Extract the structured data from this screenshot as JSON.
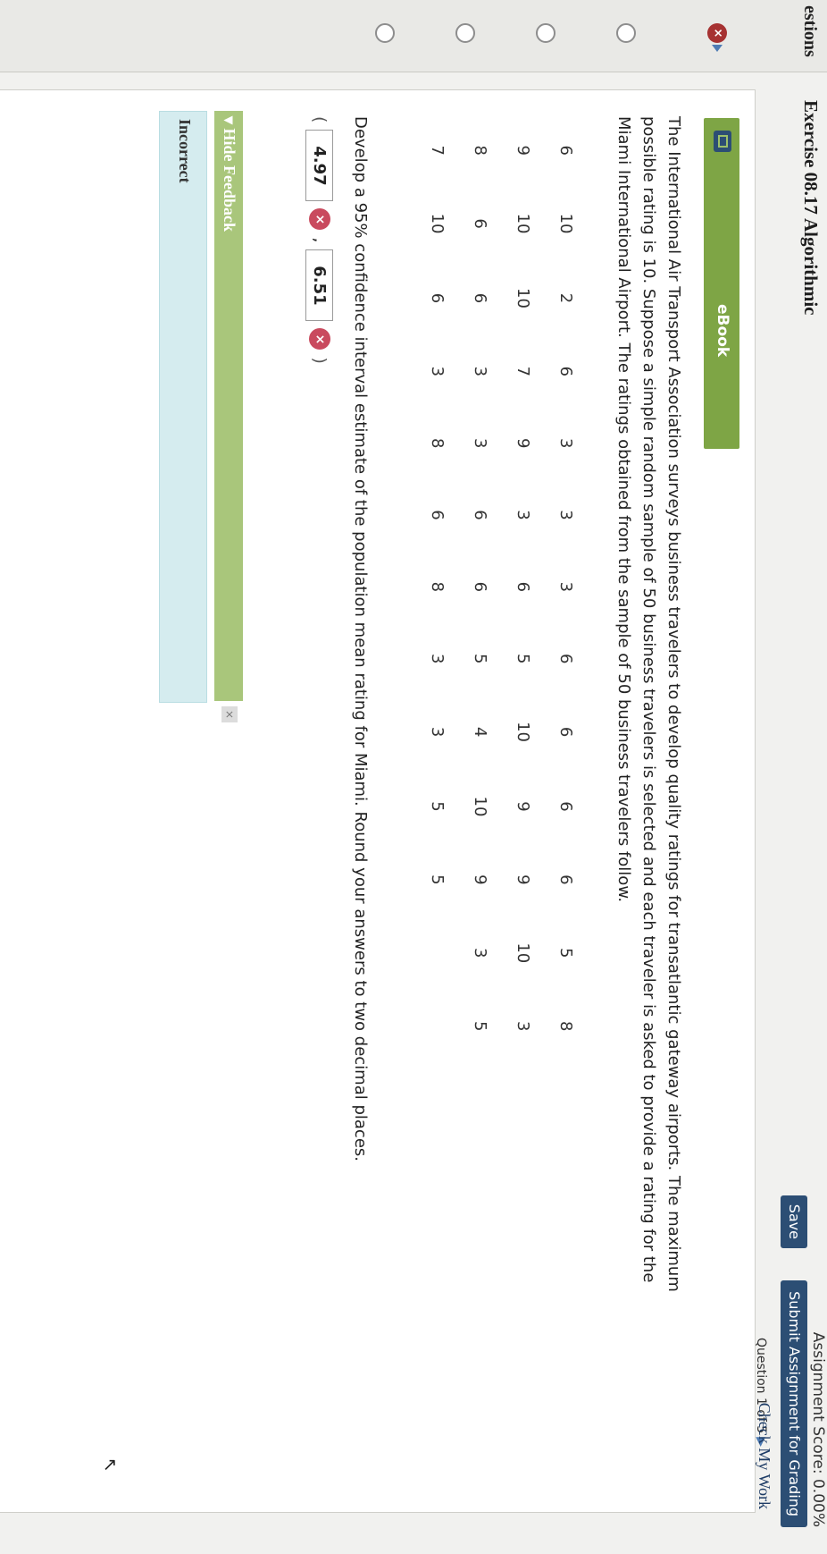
{
  "nav": {
    "label": "estions",
    "items": [
      {
        "status": "wrong",
        "glyph": "×"
      },
      {
        "status": "empty"
      },
      {
        "status": "empty"
      },
      {
        "status": "empty"
      },
      {
        "status": "empty"
      }
    ]
  },
  "header": {
    "title": "Exercise 08.17 Algorithmic",
    "score": "Assignment Score: 0.00%",
    "save": "Save",
    "submit": "Submit Assignment for Grading",
    "question_counter": "Question 1 of 5",
    "next_glyph": "▶"
  },
  "panel": {
    "check_my_work": "Check My Work",
    "ebook": "eBook",
    "problem_lines": [
      "The International Air Transport Association surveys business travelers to develop quality ratings for transatlantic gateway airports. The maximum",
      "possible rating is 10. Suppose a simple random sample of 50 business travelers is selected and each traveler is asked to provide a rating for the",
      "Miami International Airport. The ratings obtained from the sample of 50 business travelers follow."
    ],
    "ratings": [
      [
        "6",
        "10",
        "2",
        "6",
        "3",
        "3",
        "3",
        "6",
        "6",
        "6",
        "6",
        "5",
        "8"
      ],
      [
        "9",
        "10",
        "10",
        "7",
        "9",
        "3",
        "6",
        "5",
        "10",
        "9",
        "9",
        "10",
        "3"
      ],
      [
        "8",
        "6",
        "6",
        "3",
        "3",
        "6",
        "6",
        "5",
        "4",
        "10",
        "9",
        "3",
        "5"
      ],
      [
        "7",
        "10",
        "6",
        "3",
        "8",
        "6",
        "8",
        "3",
        "3",
        "5",
        "5",
        "",
        ""
      ]
    ],
    "question": "Develop a 95% confidence interval estimate of the population mean rating for Miami. Round your answers to two decimal places.",
    "answers": {
      "open": "(",
      "lower": "4.97",
      "sep": ",",
      "upper": "6.51",
      "close": ")",
      "wrong_glyph": "×"
    },
    "feedback": {
      "toggle": "▾ Hide Feedback",
      "close_glyph": "×",
      "result": "Incorrect"
    },
    "cursor_glyph": "↖"
  }
}
